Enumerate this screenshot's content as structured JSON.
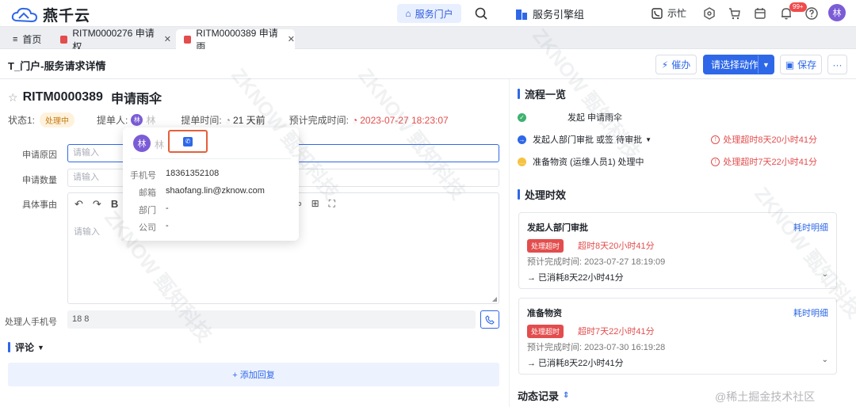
{
  "app": {
    "logo_text": "燕千云"
  },
  "topbar": {
    "portal_label": "服务门户",
    "engine_label": "服务引擎组",
    "contact_label": "示忙",
    "notif_badge": "99+",
    "user_initial": "林"
  },
  "tabs": [
    {
      "label": "首页"
    },
    {
      "label": "RITM0000276 申请权"
    },
    {
      "label": "RITM0000389 申请雨"
    }
  ],
  "tab_close": "✕",
  "header": {
    "title": "T_门户-服务请求详情",
    "urge_label": "催办",
    "action_label": "请选择动作",
    "save_label": "保存",
    "more_label": "···"
  },
  "ticket": {
    "number": "RITM0000389",
    "name": "申请雨伞",
    "status_label": "状态1:",
    "status": "处理中",
    "submitter_label": "提单人:",
    "submitter_initial": "林",
    "submitter_name": "林",
    "submit_time_label": "提单时间:",
    "submit_time": "21 天前",
    "due_label": "预计完成时间:",
    "due_time": "2023-07-27 18:23:07"
  },
  "form": {
    "reason_label": "申请原因",
    "reason_placeholder": "请输入",
    "qty_label": "申请数量",
    "qty_placeholder": "请输入",
    "detail_label": "具体事由",
    "detail_placeholder": "请输入",
    "phone_label": "处理人手机号",
    "phone_value": "18          8"
  },
  "comment": {
    "title": "评论",
    "add_reply": "+ 添加回复"
  },
  "popover": {
    "initial": "林",
    "name": "林",
    "phone_label": "手机号",
    "phone": "18361352108",
    "email_label": "邮箱",
    "email": "shaofang.lin@zknow.com",
    "dept_label": "部门",
    "dept": "-",
    "company_label": "公司",
    "company": "-"
  },
  "flow": {
    "title": "流程一览",
    "steps": [
      {
        "label": "发起  申请雨伞",
        "status": "done",
        "overdue": ""
      },
      {
        "label": "发起人部门审批  或签  待审批",
        "status": "current",
        "overdue": "处理超时8天20小时41分"
      },
      {
        "label": "准备物资 (运维人员1) 处理中",
        "status": "pending",
        "overdue": "处理超时7天22小时41分"
      }
    ]
  },
  "timing": {
    "title": "处理时效",
    "cards": [
      {
        "title": "发起人部门审批",
        "link": "耗时明细",
        "tag": "处理超时",
        "overdue": "超时8天20小时41分",
        "planned": "预计完成时间:  2023-07-27 18:19:09",
        "used": "→ 已消耗8天22小时41分"
      },
      {
        "title": "准备物资",
        "link": "耗时明细",
        "tag": "处理超时",
        "overdue": "超时7天22小时41分",
        "planned": "预计完成时间:  2023-07-30 16:19:28",
        "used": "→ 已消耗8天22小时41分"
      }
    ]
  },
  "dynamics": {
    "title": "动态记录"
  },
  "watermark": {
    "text": "ZKNOW 甄知科技",
    "footer": "@稀土掘金技术社区"
  },
  "colors": {
    "accent": "#2e68e8",
    "danger": "#e34d4d",
    "status": "#c27a12"
  }
}
